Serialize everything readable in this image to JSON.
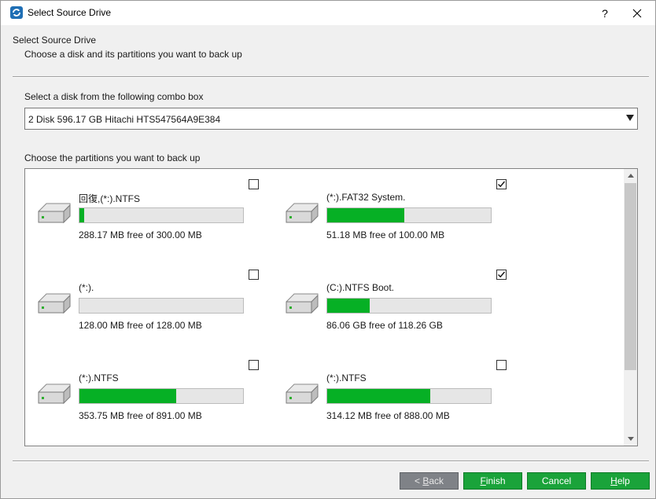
{
  "window": {
    "title": "Select Source Drive"
  },
  "titlebar_buttons": {
    "help": "?",
    "close": "✕"
  },
  "header": {
    "title": "Select Source Drive",
    "subtitle": "Choose a disk and its partitions you want to back up"
  },
  "disk_select": {
    "label": "Select a disk from the following combo box",
    "selected": "2 Disk 596.17 GB Hitachi HTS547564A9E384"
  },
  "partitions_section": {
    "label": "Choose the partitions you want to back up",
    "items": [
      {
        "name": "回復,(*:).NTFS",
        "free_text": "288.17 MB free of 300.00 MB",
        "used_fraction": 0.03,
        "checked": false
      },
      {
        "name": "(*:).FAT32 System.",
        "free_text": "51.18 MB free of 100.00 MB",
        "used_fraction": 0.47,
        "checked": true
      },
      {
        "name": "(*:).",
        "free_text": "128.00 MB free of 128.00 MB",
        "used_fraction": 0.0,
        "checked": false
      },
      {
        "name": "(C:).NTFS Boot.",
        "free_text": "86.06 GB free of 118.26 GB",
        "used_fraction": 0.26,
        "checked": true
      },
      {
        "name": "(*:).NTFS",
        "free_text": "353.75 MB free of 891.00 MB",
        "used_fraction": 0.59,
        "checked": false
      },
      {
        "name": "(*:).NTFS",
        "free_text": "314.12 MB free of 888.00 MB",
        "used_fraction": 0.63,
        "checked": false
      }
    ]
  },
  "buttons": {
    "back": {
      "arrow": "<",
      "mnemonic": "B",
      "rest": "ack"
    },
    "finish": {
      "mnemonic": "F",
      "rest": "inish"
    },
    "cancel": {
      "label": "Cancel"
    },
    "help": {
      "mnemonic": "H",
      "rest": "elp"
    }
  },
  "colors": {
    "progress_fill": "#06b025",
    "button_green": "#1aa33a",
    "button_disabled": "#7f8287"
  },
  "icons": {
    "app": "minitool-backup-icon",
    "disk": "hard-drive-icon",
    "checkmark": "checkmark-icon"
  }
}
